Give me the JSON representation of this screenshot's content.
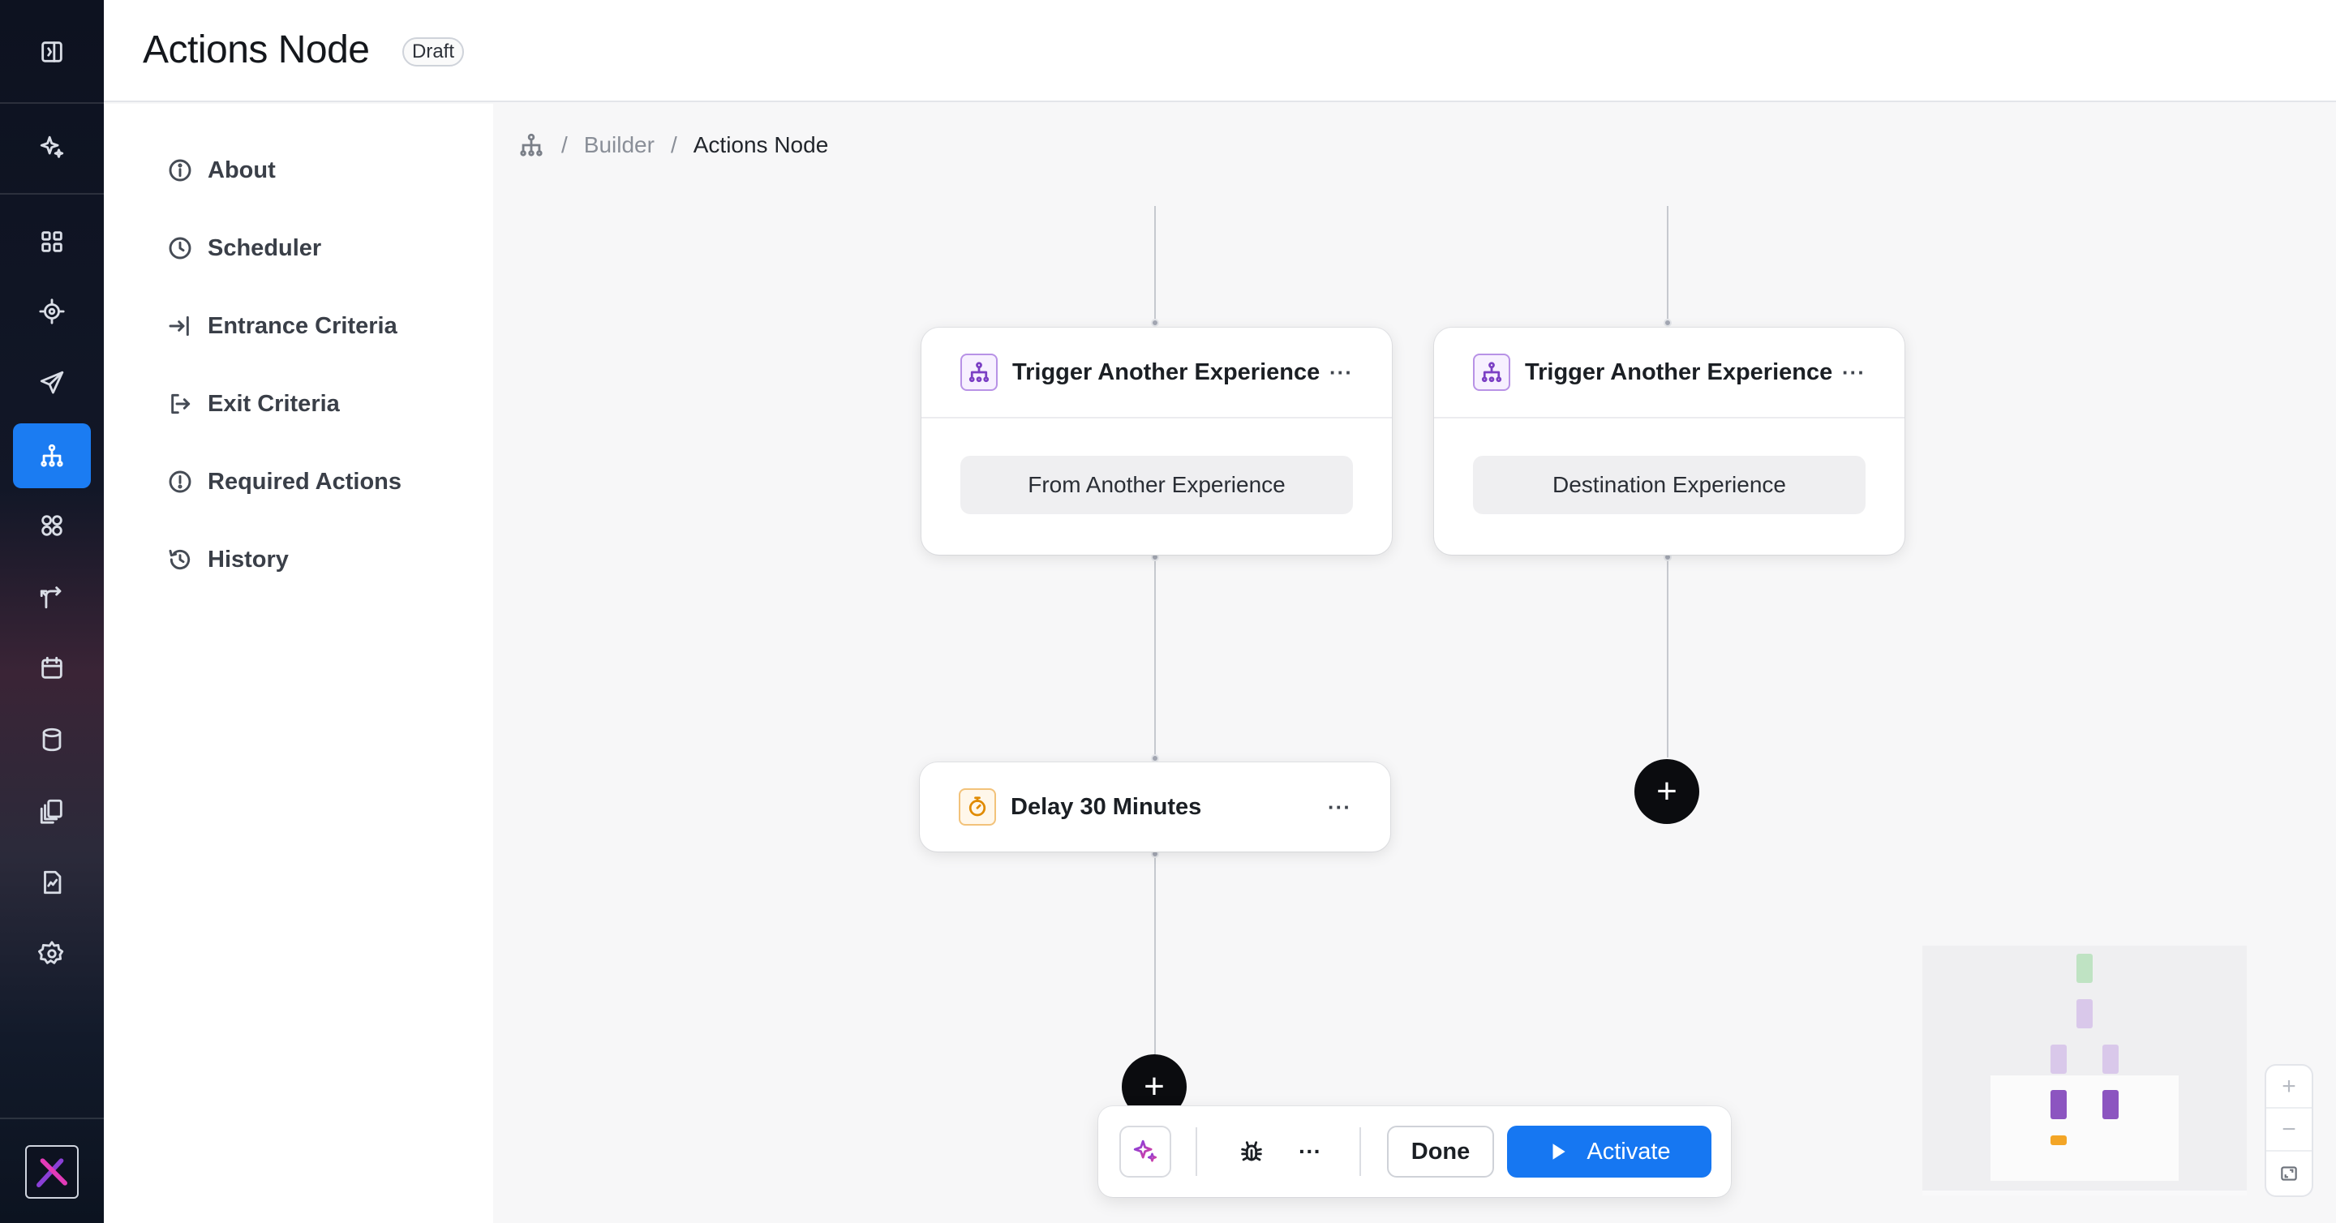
{
  "header": {
    "title": "Actions Node",
    "status_badge": "Draft"
  },
  "rail": {
    "items": [
      {
        "icon": "sidebar-toggle-icon"
      },
      {
        "icon": "sparkles-icon"
      },
      {
        "icon": "dashboard-grid-icon"
      },
      {
        "icon": "target-icon"
      },
      {
        "icon": "send-icon"
      },
      {
        "icon": "journey-tree-icon",
        "active": true
      },
      {
        "icon": "segments-icon"
      },
      {
        "icon": "routing-icon"
      },
      {
        "icon": "calendar-icon"
      },
      {
        "icon": "database-icon"
      },
      {
        "icon": "library-icon"
      },
      {
        "icon": "report-icon"
      },
      {
        "icon": "settings-icon"
      }
    ],
    "active_color": "#1b7cf2"
  },
  "subnav": {
    "items": [
      {
        "label": "About",
        "icon": "info-icon"
      },
      {
        "label": "Scheduler",
        "icon": "clock-icon"
      },
      {
        "label": "Entrance Criteria",
        "icon": "enter-icon"
      },
      {
        "label": "Exit Criteria",
        "icon": "exit-icon"
      },
      {
        "label": "Required Actions",
        "icon": "alert-icon"
      },
      {
        "label": "History",
        "icon": "history-icon"
      }
    ]
  },
  "breadcrumb": {
    "icon": "journey-tree-icon",
    "items": [
      "Builder",
      "Actions Node"
    ],
    "separator": "/"
  },
  "nodes": [
    {
      "title": "Trigger Another Experience",
      "body": "From Another Experience",
      "icon": "trigger-experience-icon",
      "more": "···"
    },
    {
      "title": "Trigger Another Experience",
      "body": "Destination Experience",
      "icon": "trigger-experience-icon",
      "more": "···"
    },
    {
      "title": "Delay 30 Minutes",
      "icon": "timer-icon",
      "more": "···"
    }
  ],
  "add_buttons": [
    {
      "label": "+"
    },
    {
      "label": "+"
    }
  ],
  "toolbar": {
    "ai_icon": "sparkles-icon",
    "debug_icon": "bug-icon",
    "more_label": "···",
    "done_label": "Done",
    "activate_label": "Activate",
    "activate_color": "#1677f2"
  },
  "zoom": {
    "in": "+",
    "out": "−",
    "fit_icon": "fit-view-icon"
  },
  "colors": {
    "trigger_icon": "#7b3fc4",
    "delay_icon": "#e08a00",
    "minimap_green": "#bfe3c3",
    "minimap_purple": "#8c55c0",
    "minimap_orange": "#f3a526"
  }
}
